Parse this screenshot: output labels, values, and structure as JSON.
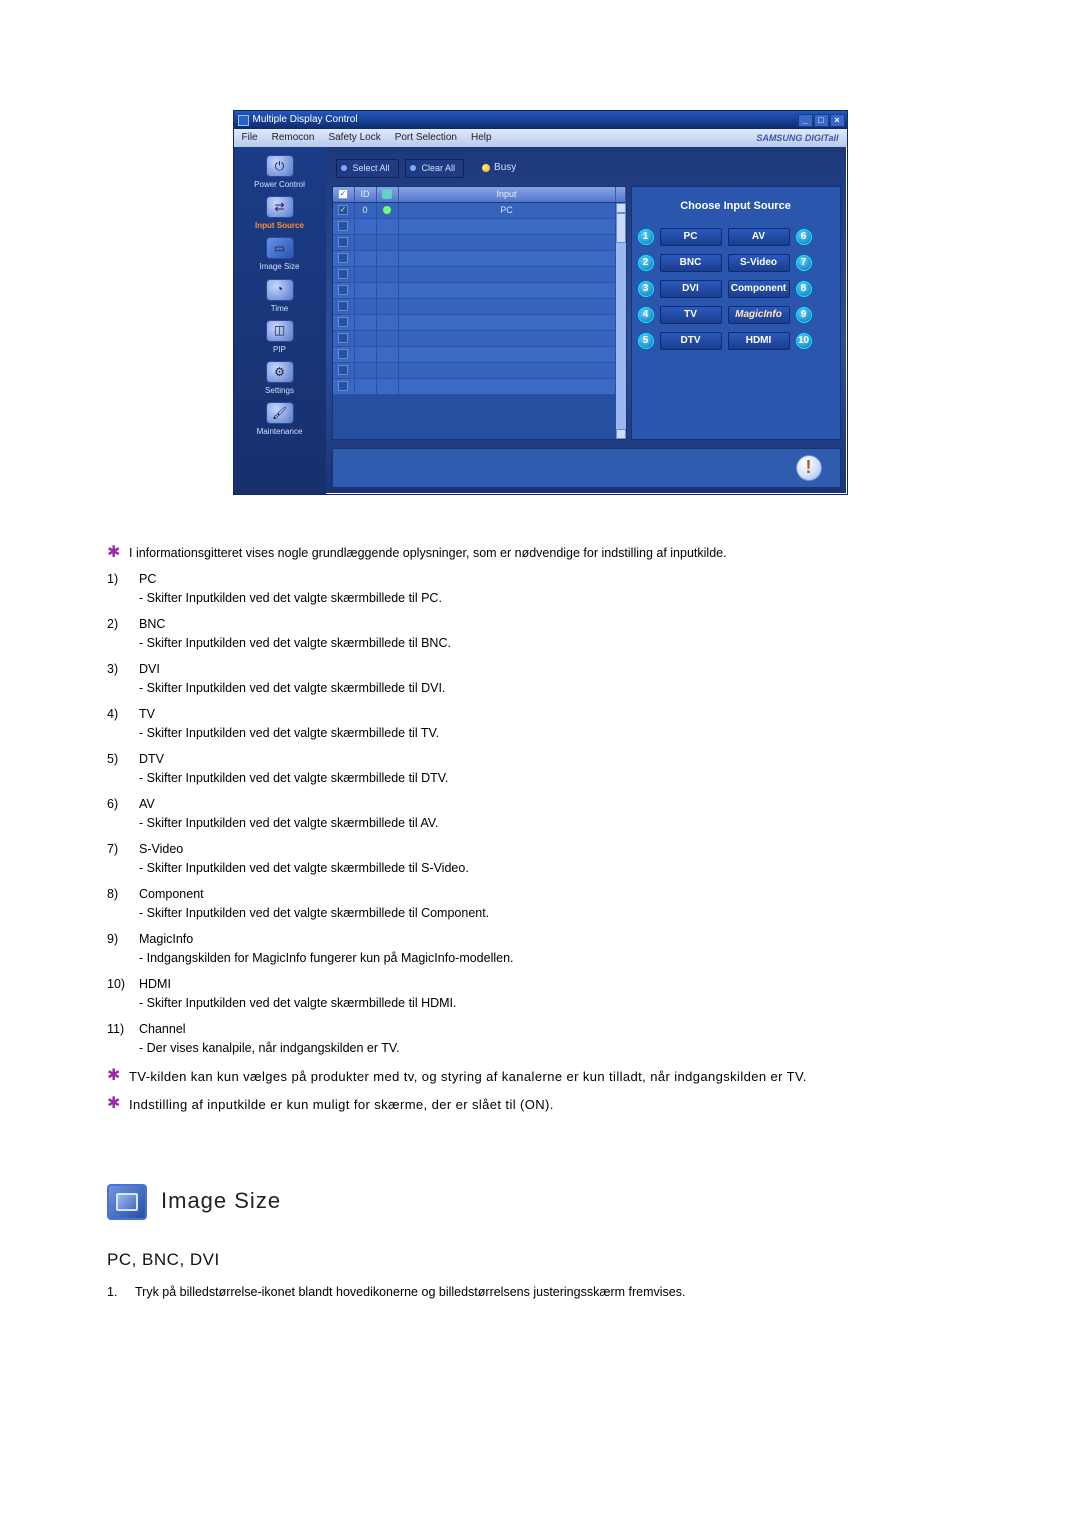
{
  "window": {
    "title": "Multiple Display Control",
    "win_min": "_",
    "win_max": "□",
    "win_close": "×"
  },
  "menu": {
    "file": "File",
    "remocon": "Remocon",
    "safety": "Safety Lock",
    "port": "Port Selection",
    "help": "Help",
    "brand": "SAMSUNG DIGITall"
  },
  "sidebar": {
    "power": "Power Control",
    "input": "Input Source",
    "image": "Image Size",
    "time": "Time",
    "pip": "PIP",
    "settings": "Settings",
    "maintenance": "Maintenance"
  },
  "toolbar": {
    "select_all": "Select All",
    "clear_all": "Clear All",
    "busy": "Busy"
  },
  "grid": {
    "col_id": "ID",
    "col_input": "Input",
    "rows": [
      {
        "checked": true,
        "id": "0",
        "status": true,
        "input": "PC"
      },
      {
        "checked": false,
        "id": "",
        "status": false,
        "input": ""
      },
      {
        "checked": false,
        "id": "",
        "status": false,
        "input": ""
      },
      {
        "checked": false,
        "id": "",
        "status": false,
        "input": ""
      },
      {
        "checked": false,
        "id": "",
        "status": false,
        "input": ""
      },
      {
        "checked": false,
        "id": "",
        "status": false,
        "input": ""
      },
      {
        "checked": false,
        "id": "",
        "status": false,
        "input": ""
      },
      {
        "checked": false,
        "id": "",
        "status": false,
        "input": ""
      },
      {
        "checked": false,
        "id": "",
        "status": false,
        "input": ""
      },
      {
        "checked": false,
        "id": "",
        "status": false,
        "input": ""
      },
      {
        "checked": false,
        "id": "",
        "status": false,
        "input": ""
      },
      {
        "checked": false,
        "id": "",
        "status": false,
        "input": ""
      }
    ]
  },
  "rightpanel": {
    "title": "Choose Input Source",
    "left": [
      {
        "num": "1",
        "label": "PC"
      },
      {
        "num": "2",
        "label": "BNC"
      },
      {
        "num": "3",
        "label": "DVI"
      },
      {
        "num": "4",
        "label": "TV"
      },
      {
        "num": "5",
        "label": "DTV"
      }
    ],
    "right": [
      {
        "num": "6",
        "label": "AV"
      },
      {
        "num": "7",
        "label": "S-Video"
      },
      {
        "num": "8",
        "label": "Component"
      },
      {
        "num": "9",
        "label": "MagicInfo"
      },
      {
        "num": "10",
        "label": "HDMI"
      }
    ]
  },
  "notes": {
    "intro": "I informationsgitteret vises nogle grundlæggende oplysninger, som er nødvendige for indstilling af inputkilde.",
    "items": [
      {
        "n": "1)",
        "label": "PC",
        "desc": "- Skifter Inputkilden ved det valgte skærmbillede til PC."
      },
      {
        "n": "2)",
        "label": "BNC",
        "desc": "- Skifter Inputkilden ved det valgte skærmbillede til BNC."
      },
      {
        "n": "3)",
        "label": "DVI",
        "desc": "- Skifter Inputkilden ved det valgte skærmbillede til DVI."
      },
      {
        "n": "4)",
        "label": "TV",
        "desc": "- Skifter Inputkilden ved det valgte skærmbillede til TV."
      },
      {
        "n": "5)",
        "label": "DTV",
        "desc": "- Skifter Inputkilden ved det valgte skærmbillede til DTV."
      },
      {
        "n": "6)",
        "label": "AV",
        "desc": "- Skifter Inputkilden ved det valgte skærmbillede til AV."
      },
      {
        "n": "7)",
        "label": "S-Video",
        "desc": "- Skifter Inputkilden ved det valgte skærmbillede til S-Video."
      },
      {
        "n": "8)",
        "label": "Component",
        "desc": "- Skifter Inputkilden ved det valgte skærmbillede til Component."
      },
      {
        "n": "9)",
        "label": "MagicInfo",
        "desc": "- Indgangskilden for MagicInfo fungerer kun på MagicInfo-modellen."
      },
      {
        "n": "10)",
        "label": "HDMI",
        "desc": "- Skifter Inputkilden ved det valgte skærmbillede til HDMI."
      },
      {
        "n": "11)",
        "label": "Channel",
        "desc": "- Der vises kanalpile, når indgangskilden er TV."
      }
    ],
    "star1": "TV-kilden kan kun vælges på produkter med tv, og styring af kanalerne er kun tilladt, når indgangskilden er TV.",
    "star2": "Indstilling af inputkilde er kun muligt for skærme, der er slået til (ON)."
  },
  "section": {
    "title": "Image Size",
    "subhead": "PC, BNC, DVI",
    "step1_n": "1.",
    "step1": "Tryk på billedstørrelse-ikonet blandt hovedikonerne og billedstørrelsens justeringsskærm fremvises."
  }
}
